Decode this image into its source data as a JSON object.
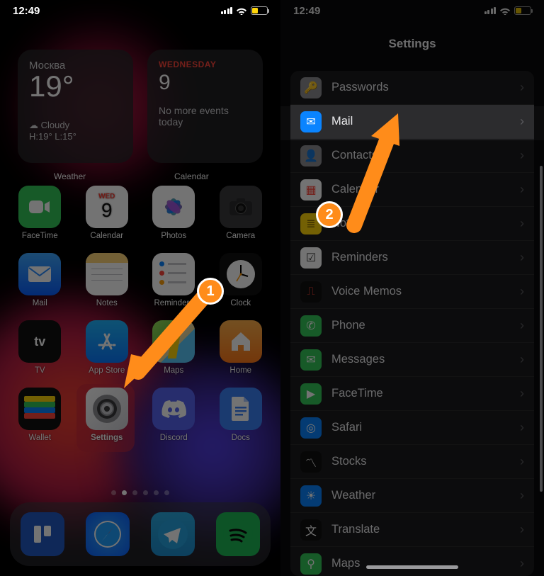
{
  "statusbar": {
    "time": "12:49"
  },
  "weather": {
    "city": "Москва",
    "temp": "19°",
    "condition": "Cloudy",
    "hi_lo": "H:19° L:15°",
    "widget_label": "Weather"
  },
  "calendar": {
    "day": "WEDNESDAY",
    "date": "9",
    "events": "No more events today",
    "widget_label": "Calendar"
  },
  "apps_row1": [
    {
      "label": "FaceTime"
    },
    {
      "label": "Calendar",
      "sub": "WED",
      "sub2": "9"
    },
    {
      "label": "Photos"
    },
    {
      "label": "Camera"
    }
  ],
  "apps_row2": [
    {
      "label": "Mail"
    },
    {
      "label": "Notes"
    },
    {
      "label": "Reminders"
    },
    {
      "label": "Clock"
    }
  ],
  "apps_row3": [
    {
      "label": "TV"
    },
    {
      "label": "App Store"
    },
    {
      "label": "Maps"
    },
    {
      "label": "Home"
    }
  ],
  "apps_row4": [
    {
      "label": "Wallet"
    },
    {
      "label": "Settings"
    },
    {
      "label": "Discord"
    },
    {
      "label": "Docs"
    }
  ],
  "settings": {
    "title": "Settings",
    "items": [
      {
        "label": "Passwords"
      },
      {
        "label": "Mail"
      },
      {
        "label": "Contacts"
      },
      {
        "label": "Calendar"
      },
      {
        "label": "Notes"
      },
      {
        "label": "Reminders"
      },
      {
        "label": "Voice Memos"
      },
      {
        "label": "Phone"
      },
      {
        "label": "Messages"
      },
      {
        "label": "FaceTime"
      },
      {
        "label": "Safari"
      },
      {
        "label": "Stocks"
      },
      {
        "label": "Weather"
      },
      {
        "label": "Translate"
      },
      {
        "label": "Maps"
      }
    ]
  },
  "annotations": {
    "step1": "1",
    "step2": "2"
  }
}
